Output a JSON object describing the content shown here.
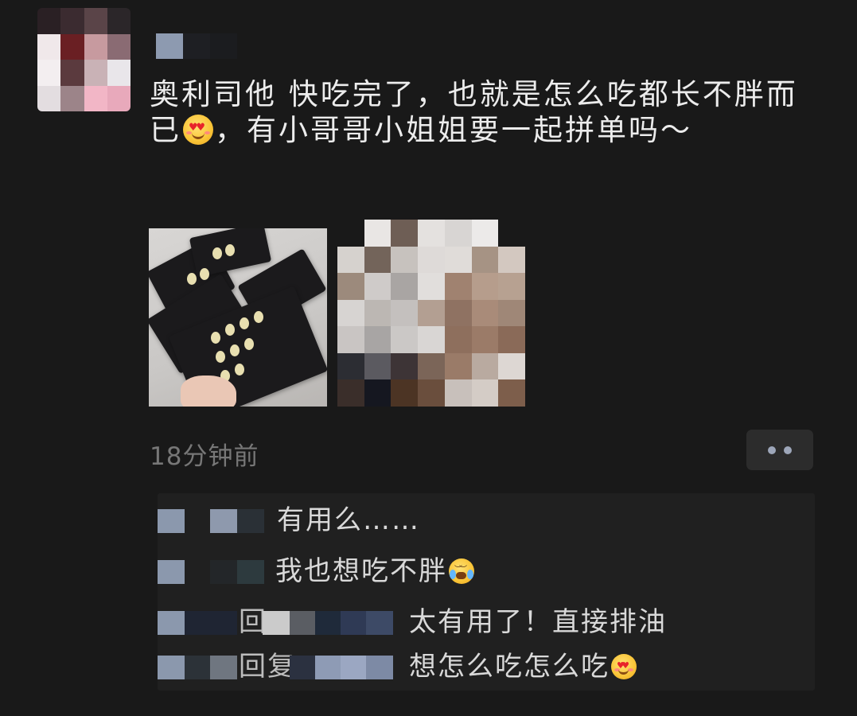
{
  "post": {
    "avatar_description": "pixelated-avatar",
    "username_hidden": true,
    "text_part1": "奥利司他 快吃完了，也就是怎么吃都长不胖而已",
    "emoji_1": "heart-eyes-emoji",
    "text_part2": "，有小哥哥小姐姐要一起拼单吗～",
    "images": [
      "pill-cards-photo",
      "pixelated-photo"
    ],
    "timestamp": "18分钟前"
  },
  "actions": {
    "more_icon": "more-dots-icon"
  },
  "comments": [
    {
      "author_hidden": true,
      "text": "有用么……"
    },
    {
      "author_hidden": true,
      "text": "我也想吃不胖",
      "emoji": "crying-laughing-emoji"
    },
    {
      "author_hidden": true,
      "reply_prefix": "回",
      "text": "太有用了！直接排油"
    },
    {
      "author_hidden": true,
      "reply_prefix": "回复",
      "text": "想怎么吃怎么吃",
      "emoji": "heart-eyes-emoji"
    }
  ],
  "colors": {
    "background": "#191919",
    "comment_bg": "#202020",
    "timestamp": "#777777",
    "dots": "#9da6b9"
  }
}
